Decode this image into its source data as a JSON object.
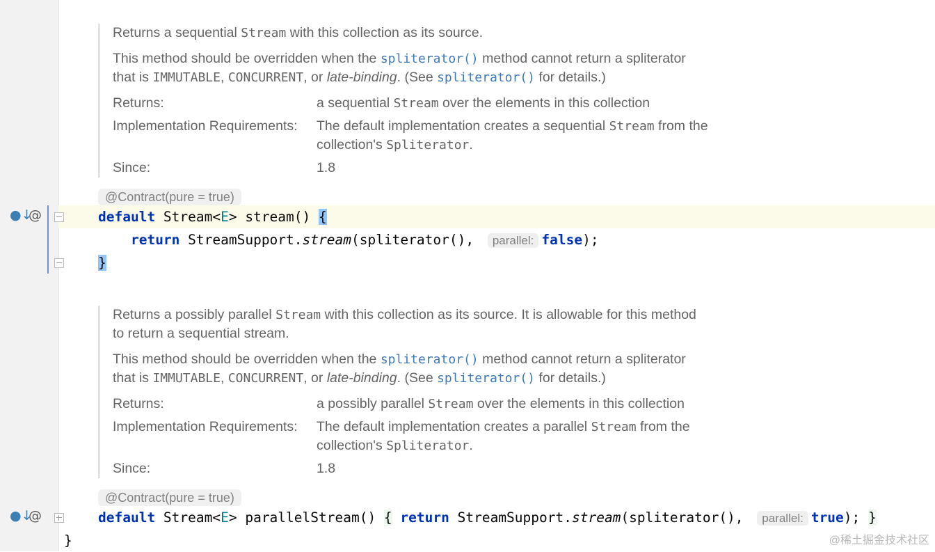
{
  "doc1": {
    "line1": [
      "Returns a sequential ",
      "Stream",
      " with this collection as its source."
    ],
    "line2": [
      "This method should be overridden when the ",
      "spliterator()",
      " method cannot return a spliterator"
    ],
    "line3": [
      "that is ",
      "IMMUTABLE",
      ", ",
      "CONCURRENT",
      ", or ",
      "late-binding",
      ". (See ",
      "spliterator()",
      " for details.)"
    ],
    "returns_label": "Returns:",
    "returns_value": [
      "a sequential ",
      "Stream",
      " over the elements in this collection"
    ],
    "impl_label": "Implementation Requirements:",
    "impl_value1": [
      "The default implementation creates a sequential ",
      "Stream",
      " from the"
    ],
    "impl_value2": [
      "collection's ",
      "Spliterator",
      "."
    ],
    "since_label": "Since:",
    "since_value": "1.8"
  },
  "annotation1": "@Contract(pure = true)",
  "code1": {
    "kw_default": "default",
    "sig_a": " Stream<",
    "type_param": "E",
    "sig_b": "> stream() ",
    "open_brace": "{",
    "indent": "    ",
    "kw_return": "return",
    "call_a": " StreamSupport.",
    "call_method": "stream",
    "call_b": "(spliterator(), ",
    "hint": "parallel:",
    "value": "false",
    "end": ");",
    "close_brace": "}"
  },
  "doc2": {
    "line1": [
      "Returns a possibly parallel ",
      "Stream",
      " with this collection as its source. It is allowable for this method"
    ],
    "line1b": "to return a sequential stream.",
    "line2": [
      "This method should be overridden when the ",
      "spliterator()",
      " method cannot return a spliterator"
    ],
    "line3": [
      "that is ",
      "IMMUTABLE",
      ", ",
      "CONCURRENT",
      ", or ",
      "late-binding",
      ". (See ",
      "spliterator()",
      " for details.)"
    ],
    "returns_label": "Returns:",
    "returns_value": [
      "a possibly parallel ",
      "Stream",
      " over the elements in this collection"
    ],
    "impl_label": "Implementation Requirements:",
    "impl_value1": [
      "The default implementation creates a parallel ",
      "Stream",
      " from the"
    ],
    "impl_value2": [
      "collection's ",
      "Spliterator",
      "."
    ],
    "since_label": "Since:",
    "since_value": "1.8"
  },
  "annotation2": "@Contract(pure = true)",
  "code2": {
    "kw_default": "default",
    "sig_a": " Stream<",
    "type_param": "E",
    "sig_b": "> parallelStream() ",
    "open_brace": "{",
    "kw_return": "return",
    "call_a": " StreamSupport.",
    "call_method": "stream",
    "call_b": "(spliterator(), ",
    "hint": "parallel:",
    "value": "true",
    "end": "); ",
    "close_brace": "}"
  },
  "class_close": "}",
  "gutter": {
    "implementing_icon": "●↓",
    "annotation_icon": "@"
  },
  "watermark": "@稀土掘金技术社区",
  "colors": {
    "keyword": "#0033b3",
    "link": "#3f7ab8",
    "type_param": "#007e8a",
    "caret_line": "#fcfae9",
    "brace_match": "#93c6f8"
  }
}
